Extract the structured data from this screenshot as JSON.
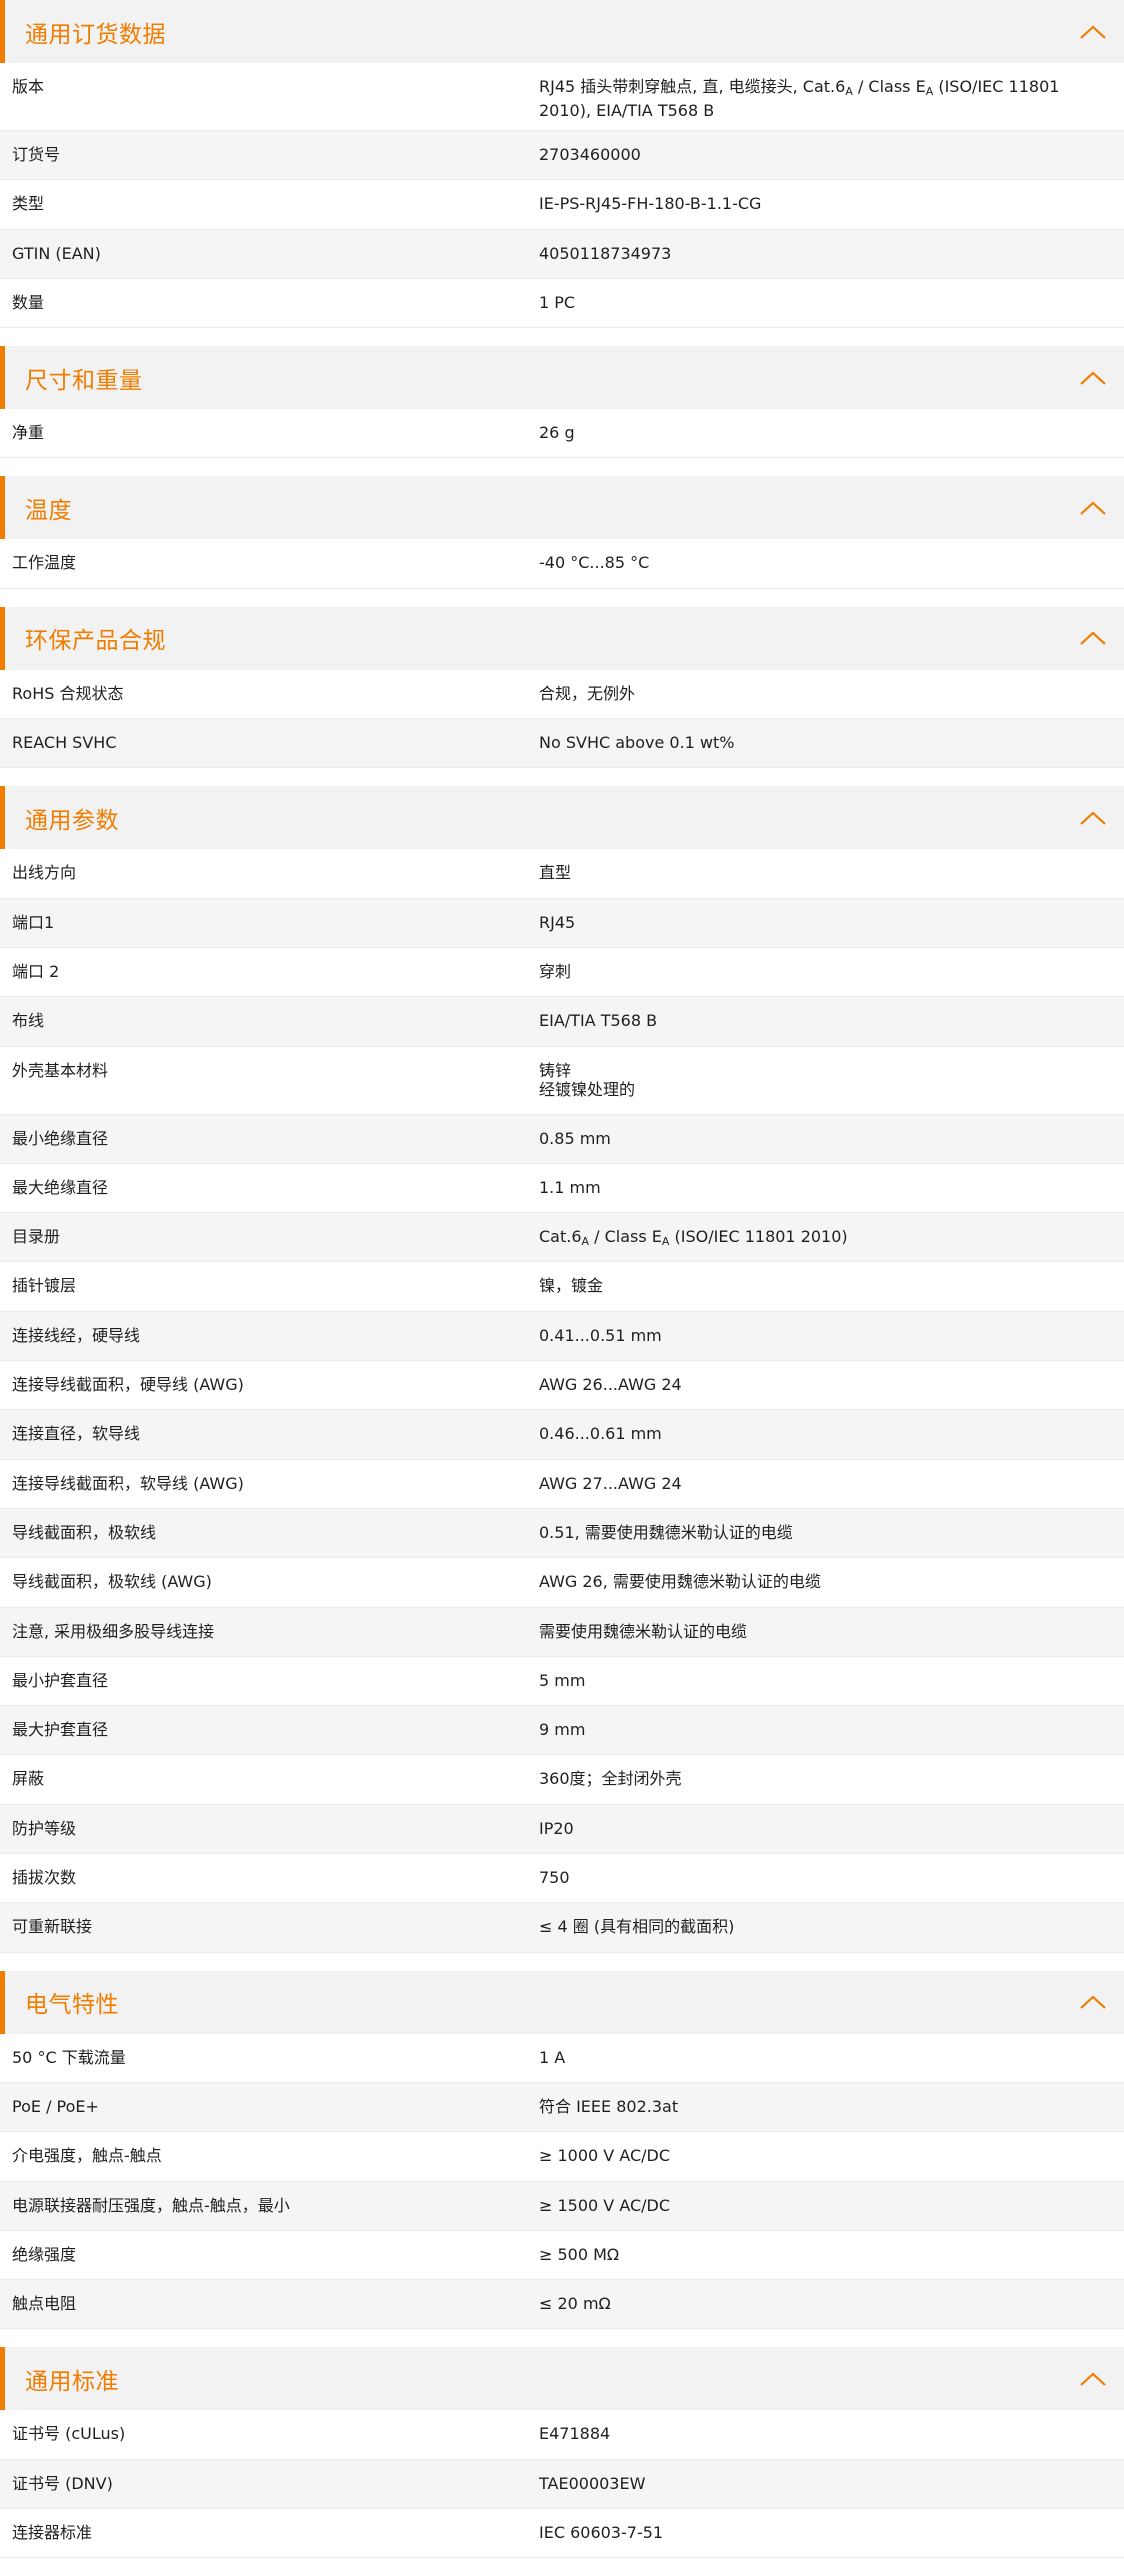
{
  "colors": {
    "accent": "#f07d00",
    "header_bg": "#f2f2f2",
    "row_alt": "#f5f5f5"
  },
  "icons": {
    "section_toggle": "chevron-up-icon"
  },
  "sections": [
    {
      "id": "general-ordering",
      "title": "通用订货数据",
      "rows": [
        {
          "label": "版本",
          "value_html": "RJ45 插头带刺穿触点, 直, 电缆接头, Cat.6<span class=\"sub\">A</span> / Class E<span class=\"sub\">A</span> (ISO/IEC 11801<br>2010), EIA/TIA T568 B",
          "tall": true
        },
        {
          "label": "订货号",
          "value": "2703460000"
        },
        {
          "label": "类型",
          "value": "IE-PS-RJ45-FH-180-B-1.1-CG"
        },
        {
          "label": "GTIN (EAN)",
          "value": "4050118734973"
        },
        {
          "label": "数量",
          "value": "1  PC"
        }
      ]
    },
    {
      "id": "dimensions-weight",
      "title": "尺寸和重量",
      "rows": [
        {
          "label": "净重",
          "value": "26  g"
        }
      ]
    },
    {
      "id": "temperature",
      "title": "温度",
      "rows": [
        {
          "label": "工作温度",
          "value": "-40 °C...85 °C"
        }
      ]
    },
    {
      "id": "environmental-compliance",
      "title": "环保产品合规",
      "rows": [
        {
          "label": "RoHS 合规状态",
          "value": "合规，无例外"
        },
        {
          "label": "REACH SVHC",
          "value": "No SVHC above 0.1 wt%"
        }
      ]
    },
    {
      "id": "general-parameters",
      "title": "通用参数",
      "rows": [
        {
          "label": "出线方向",
          "value": "直型"
        },
        {
          "label": "端口1",
          "value": "RJ45"
        },
        {
          "label": "端口 2",
          "value": "穿刺"
        },
        {
          "label": "布线",
          "value": "EIA/TIA T568 B"
        },
        {
          "label": "外壳基本材料",
          "value_html": "铸锌<br>经镀镍处理的",
          "tall": true
        },
        {
          "label": "最小绝缘直径",
          "value": "0.85  mm"
        },
        {
          "label": "最大绝缘直径",
          "value": "1.1  mm"
        },
        {
          "label": "目录册",
          "value_html": "Cat.6<span class=\"sub\">A</span> / Class E<span class=\"sub\">A</span> (ISO/IEC 11801 2010)"
        },
        {
          "label": "插针镀层",
          "value": "镍，镀金"
        },
        {
          "label": "连接线经，硬导线",
          "value": "0.41...0.51 mm"
        },
        {
          "label": "连接导线截面积，硬导线 (AWG)",
          "value": "AWG 26...AWG 24"
        },
        {
          "label": "连接直径，软导线",
          "value": "0.46...0.61 mm"
        },
        {
          "label": "连接导线截面积，软导线 (AWG)",
          "value": "AWG 27...AWG 24"
        },
        {
          "label": "导线截面积，极软线",
          "value": "0.51, 需要使用魏德米勒认证的电缆"
        },
        {
          "label": "导线截面积，极软线 (AWG)",
          "value": "AWG 26, 需要使用魏德米勒认证的电缆"
        },
        {
          "label": "注意, 采用极细多股导线连接",
          "value": "需要使用魏德米勒认证的电缆"
        },
        {
          "label": "最小护套直径",
          "value": "5  mm"
        },
        {
          "label": "最大护套直径",
          "value": "9  mm"
        },
        {
          "label": "屏蔽",
          "value": "360度；全封闭外壳"
        },
        {
          "label": "防护等级",
          "value": "IP20"
        },
        {
          "label": "插拔次数",
          "value": "750"
        },
        {
          "label": "可重新联接",
          "value": "≤ 4 圈 (具有相同的截面积)"
        }
      ]
    },
    {
      "id": "electrical-characteristics",
      "title": "电气特性",
      "rows": [
        {
          "label": "50 °C 下载流量",
          "value": "1  A"
        },
        {
          "label": "PoE / PoE+",
          "value": "符合 IEEE 802.3at"
        },
        {
          "label": "介电强度，触点-触点",
          "value": "≥ 1000 V AC/DC"
        },
        {
          "label": "电源联接器耐压强度，触点-触点，最小",
          "value": "≥ 1500 V AC/DC"
        },
        {
          "label": "绝缘强度",
          "value": "≥ 500 MΩ"
        },
        {
          "label": "触点电阻",
          "value": "≤ 20 mΩ"
        }
      ]
    },
    {
      "id": "general-standards",
      "title": "通用标准",
      "rows": [
        {
          "label": "证书号 (cULus)",
          "value": "E471884"
        },
        {
          "label": "证书号 (DNV)",
          "value": "TAE00003EW"
        },
        {
          "label": "连接器标准",
          "value": "IEC 60603-7-51"
        }
      ]
    }
  ]
}
